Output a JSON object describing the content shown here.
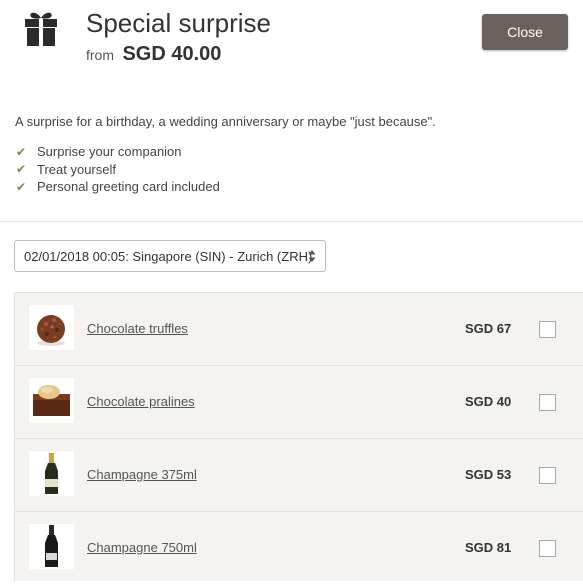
{
  "header": {
    "title": "Special surprise",
    "from_label": "from",
    "price": "SGD  40.00",
    "close_label": "Close"
  },
  "description": "A surprise for a birthday, a wedding anniversary or maybe \"just because\".",
  "features": [
    "Surprise your companion",
    "Treat yourself",
    "Personal greeting card included"
  ],
  "flight_select": {
    "selected": "02/01/2018 00:05: Singapore (SIN) - Zurich (ZRH)"
  },
  "products": [
    {
      "name": "Chocolate truffles",
      "price": "SGD  67",
      "checked": false,
      "image": "truffle-image"
    },
    {
      "name": "Chocolate pralines",
      "price": "SGD  40",
      "checked": false,
      "image": "praline-image"
    },
    {
      "name": "Champagne 375ml",
      "price": "SGD  53",
      "checked": false,
      "image": "champagne-small-image"
    },
    {
      "name": "Champagne 750ml",
      "price": "SGD  81",
      "checked": false,
      "image": "champagne-large-image"
    }
  ],
  "colors": {
    "button": "#6b625b",
    "check": "#7a8a48",
    "panel": "#f4f3f0"
  }
}
